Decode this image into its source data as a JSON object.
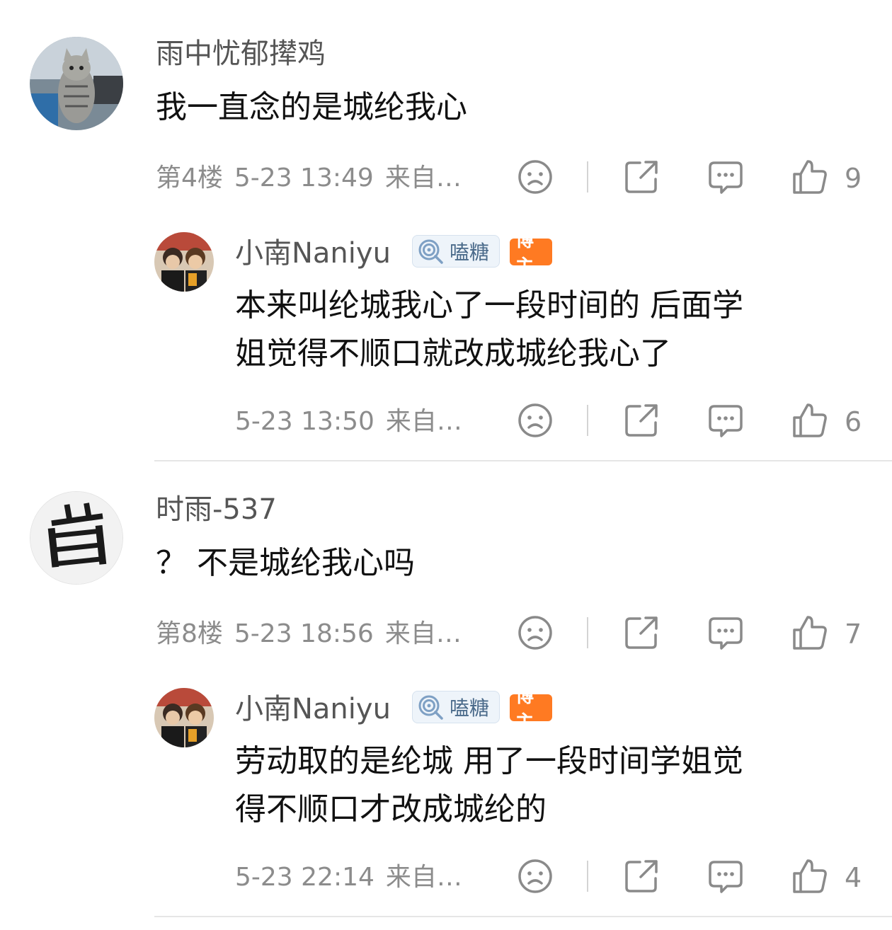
{
  "comments": [
    {
      "user": "雨中忧郁撵鸡",
      "text": "我一直念的是城纶我心",
      "floor": "第4楼",
      "time": "5-23 13:49",
      "source": "来自…",
      "likes": "9",
      "reply": {
        "user": "小南Naniyu",
        "candy_badge": "嗑糖",
        "author_badge": "博主",
        "text_lines": [
          "本来叫纶城我心了一段时间的 后面学",
          "姐觉得不顺口就改成城纶我心了"
        ],
        "time": "5-23 13:50",
        "source": "来自…",
        "likes": "6"
      }
    },
    {
      "user": "时雨-537",
      "text": "？ 不是城纶我心吗",
      "floor": "第8楼",
      "time": "5-23 18:56",
      "source": "来自…",
      "likes": "7",
      "reply": {
        "user": "小南Naniyu",
        "candy_badge": "嗑糖",
        "author_badge": "博主",
        "text_lines": [
          "劳动取的是纶城 用了一段时间学姐觉",
          "得不顺口才改成城纶的"
        ],
        "time": "5-23 22:14",
        "source": "来自…",
        "likes": "4"
      }
    }
  ],
  "icons": {
    "dislike": "sad-face-icon",
    "share": "share-icon",
    "comment": "comment-bubble-icon",
    "like": "thumbs-up-icon"
  },
  "colors": {
    "author_badge": "#ff7a22",
    "candy_badge_bg": "#eef4fa",
    "meta_text": "#8c8c8c"
  }
}
